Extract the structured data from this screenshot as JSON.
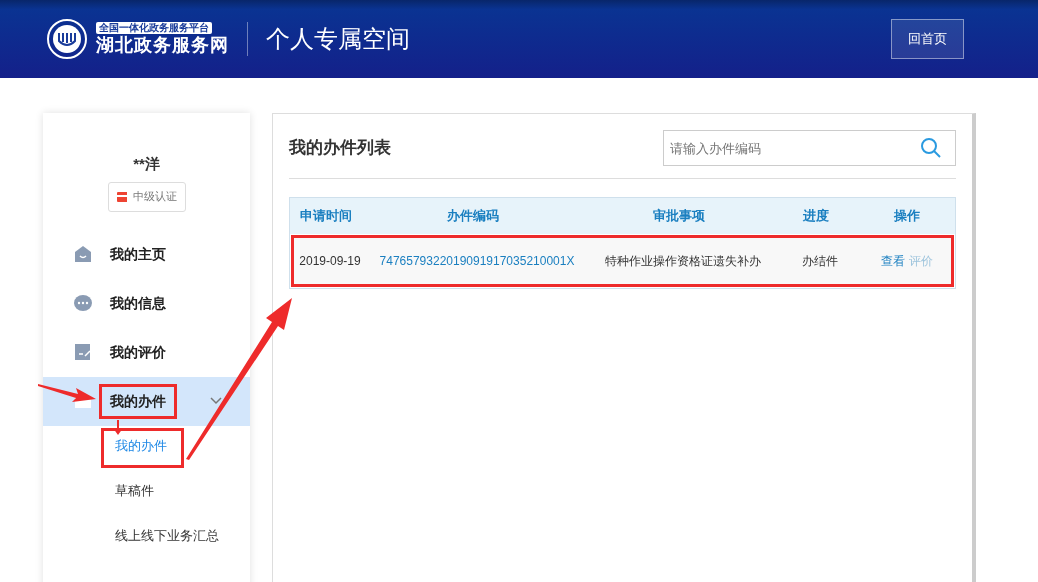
{
  "header": {
    "logo_top": "全国一体化政务服务平台",
    "logo_name": "湖北政务服务网",
    "title": "个人专属空间",
    "home_button": "回首页"
  },
  "profile": {
    "name": "**洋",
    "badge": "中级认证"
  },
  "nav": [
    {
      "label": "我的主页",
      "kind": "home",
      "selected": false,
      "highlighted": false
    },
    {
      "label": "我的信息",
      "kind": "message",
      "selected": false,
      "highlighted": false
    },
    {
      "label": "我的评价",
      "kind": "review",
      "selected": false,
      "highlighted": false
    },
    {
      "label": "我的办件",
      "kind": "folder",
      "selected": true,
      "highlighted": true,
      "expanded": true,
      "children": [
        {
          "label": "我的办件",
          "selected": true,
          "highlighted": true
        },
        {
          "label": "草稿件",
          "selected": false,
          "highlighted": false
        },
        {
          "label": "线上线下业务汇总",
          "selected": false,
          "highlighted": false
        }
      ]
    }
  ],
  "panel": {
    "title": "我的办件列表",
    "search": {
      "placeholder": "请输入办件编码"
    }
  },
  "table": {
    "columns": [
      "申请时间",
      "办件编码",
      "审批事项",
      "进度",
      "操作"
    ],
    "rows": [
      {
        "date": "2019-09-19",
        "code": "7476579322019091917035210001X",
        "item": "特种作业操作资格证遗失补办",
        "status": "办结件",
        "actions": [
          {
            "label": "查看",
            "disabled": false
          },
          {
            "label": "评价",
            "disabled": true
          }
        ],
        "highlighted": true
      }
    ]
  }
}
